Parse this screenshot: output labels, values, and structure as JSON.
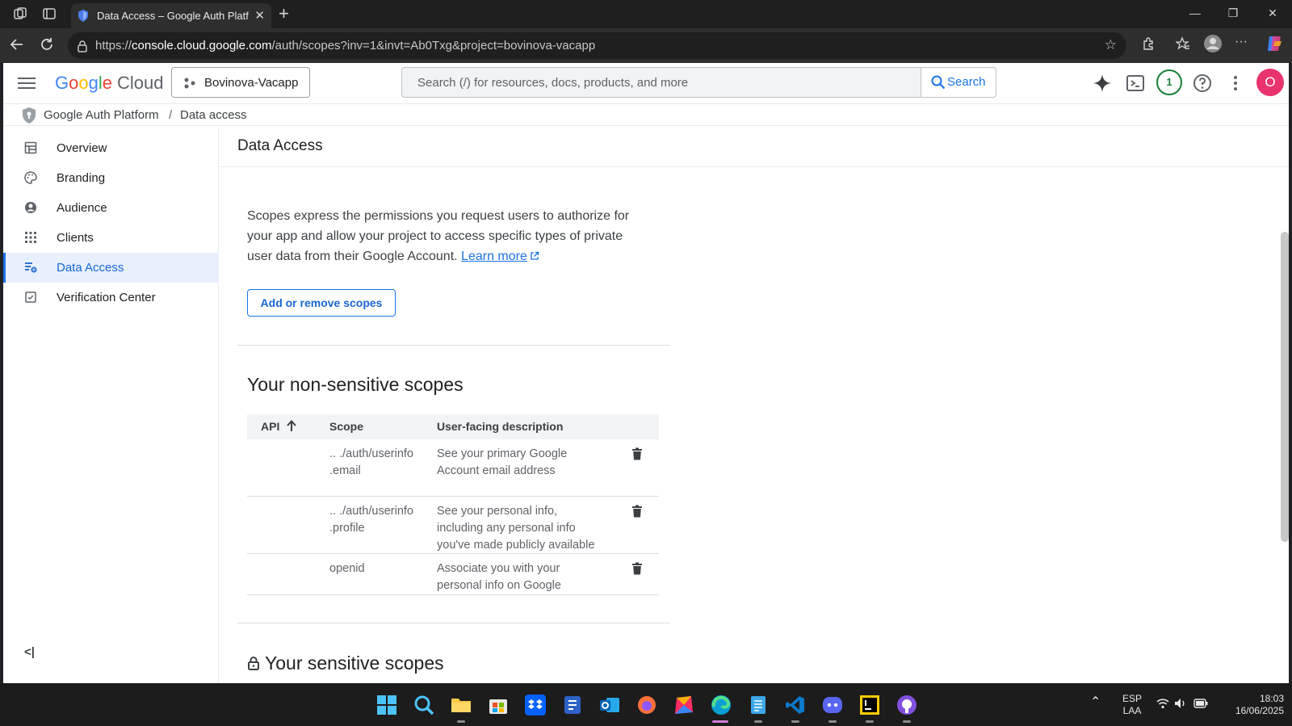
{
  "browser": {
    "tab_title": "Data Access – Google Auth Platfo",
    "url_prefix": "https://",
    "url_host": "console.cloud.google.com",
    "url_path": "/auth/scopes?inv=1&invt=Ab0Txg&project=bovinova-vacapp"
  },
  "header": {
    "logo_google": [
      "G",
      "o",
      "o",
      "g",
      "l",
      "e"
    ],
    "logo_cloud": "Cloud",
    "project": "Bovinova-Vacapp",
    "search_placeholder": "Search (/) for resources, docs, products, and more",
    "search_button": "Search",
    "notification_count": "1",
    "avatar_initial": "O"
  },
  "breadcrumb": {
    "root": "Google Auth Platform",
    "separator": "/",
    "current": "Data access"
  },
  "sidebar": {
    "items": [
      {
        "label": "Overview",
        "icon": "dashboard-icon"
      },
      {
        "label": "Branding",
        "icon": "palette-icon"
      },
      {
        "label": "Audience",
        "icon": "account-circle-icon"
      },
      {
        "label": "Clients",
        "icon": "grid-icon"
      },
      {
        "label": "Data Access",
        "icon": "data-access-icon",
        "active": true
      },
      {
        "label": "Verification Center",
        "icon": "verified-checkbox-icon"
      }
    ],
    "collapse_label": "<|"
  },
  "main": {
    "title": "Data Access",
    "description": "Scopes express the permissions you request users to authorize for your app and allow your project to access specific types of private user data from their Google Account.",
    "learn_more": "Learn more",
    "add_remove_button": "Add or remove scopes",
    "non_sensitive_heading": "Your non-sensitive scopes",
    "table": {
      "columns": [
        "API",
        "Scope",
        "User-facing description"
      ],
      "rows": [
        {
          "api": "",
          "scope": ".. ./auth/userinfo .email",
          "description": "See your primary Google Account email address"
        },
        {
          "api": "",
          "scope": ".. ./auth/userinfo .profile",
          "description": "See your personal info, including any personal info you've made publicly available"
        },
        {
          "api": "",
          "scope": "openid",
          "description": "Associate you with your personal info on Google"
        }
      ]
    },
    "sensitive_heading": "Your sensitive scopes"
  },
  "taskbar": {
    "language": "ESP",
    "layout": "LAA",
    "time": "18:03",
    "date": "16/06/2025"
  },
  "colors": {
    "accent": "#1a73e8",
    "active_bg": "#e8f0fe",
    "avatar": "#e8336d"
  }
}
